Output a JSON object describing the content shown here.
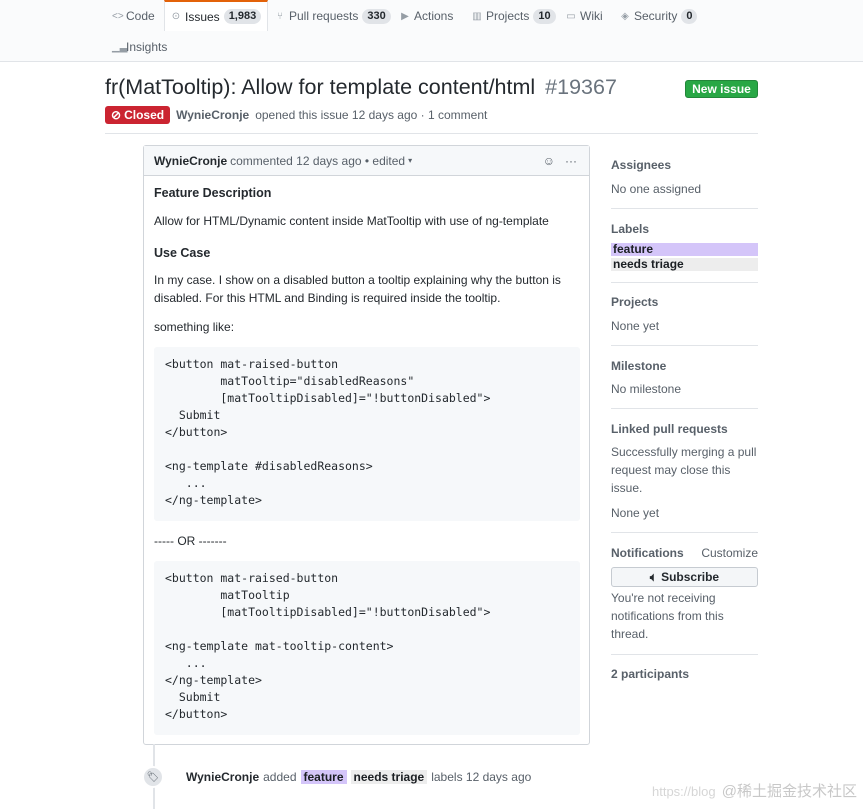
{
  "nav": {
    "tabs": [
      {
        "label": "Code",
        "icon": "code-icon"
      },
      {
        "label": "Issues",
        "count": "1,983",
        "icon": "issue-opened-icon"
      },
      {
        "label": "Pull requests",
        "count": "330",
        "icon": "git-pull-request-icon"
      },
      {
        "label": "Actions",
        "icon": "play-icon"
      },
      {
        "label": "Projects",
        "count": "10",
        "icon": "project-icon"
      },
      {
        "label": "Wiki",
        "icon": "book-icon"
      },
      {
        "label": "Security",
        "count": "0",
        "icon": "shield-icon"
      },
      {
        "label": "Insights",
        "icon": "graph-icon"
      }
    ]
  },
  "issue": {
    "title": "fr(MatTooltip): Allow for template content/html",
    "number": "#19367",
    "state": "Closed",
    "author": "WynieCronje",
    "meta_text": "opened this issue 12 days ago · 1 comment",
    "new_issue_label": "New issue"
  },
  "comment": {
    "author": "WynieCronje",
    "header_text": "commented 12 days ago • edited",
    "emoji_icon": "☺",
    "more_icon": "···",
    "heading_feature": "Feature Description",
    "feature_text": "Allow for HTML/Dynamic content inside MatTooltip with use of ng-template",
    "heading_usecase": "Use Case",
    "usecase_text": "In my case. I show on a disabled button a tooltip explaining why the button is disabled. For this HTML and Binding is required inside the tooltip.",
    "something_like": "something like:",
    "code1": "<button mat-raised-button\n        matTooltip=\"disabledReasons\"\n        [matTooltipDisabled]=\"!buttonDisabled\">\n  Submit\n</button>\n\n<ng-template #disabledReasons>\n   ...\n</ng-template>",
    "or_text": "----- OR -------",
    "code2": "<button mat-raised-button\n        matTooltip\n        [matTooltipDisabled]=\"!buttonDisabled\">\n\n<ng-template mat-tooltip-content>\n   ...\n</ng-template>\n  Submit\n</button>"
  },
  "sidebar": {
    "assignees": {
      "heading": "Assignees",
      "text": "No one assigned"
    },
    "labels": {
      "heading": "Labels",
      "items": [
        {
          "name": "feature",
          "color": "#d4c5f9"
        },
        {
          "name": "needs triage",
          "color": "#ededed"
        }
      ]
    },
    "projects": {
      "heading": "Projects",
      "text": "None yet"
    },
    "milestone": {
      "heading": "Milestone",
      "text": "No milestone"
    },
    "linked": {
      "heading": "Linked pull requests",
      "text": "Successfully merging a pull request may close this issue.",
      "none": "None yet"
    },
    "notifications": {
      "heading": "Notifications",
      "customize": "Customize",
      "subscribe": "Subscribe",
      "text": "You're not receiving notifications from this thread."
    },
    "participants": "2 participants"
  },
  "event": {
    "author": "WynieCronje",
    "added": "added",
    "labels": [
      {
        "name": "feature",
        "color": "#d4c5f9"
      },
      {
        "name": "needs triage",
        "color": "#ededed"
      }
    ],
    "suffix": "labels 12 days ago"
  },
  "watermark": {
    "url": "https://blog",
    "text": "@稀土掘金技术社区"
  }
}
